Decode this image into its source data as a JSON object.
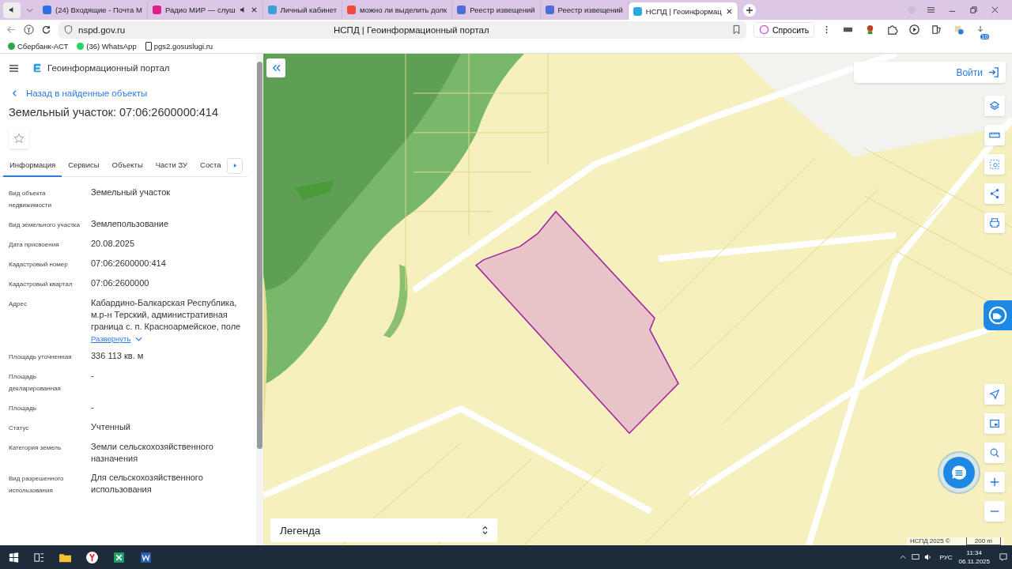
{
  "browser": {
    "tabs": [
      {
        "title": "(24) Входящие - Почта М",
        "selected": false,
        "playing": false,
        "color": "#2f6fe0"
      },
      {
        "title": "Радио МИР — слуш",
        "selected": false,
        "playing": true,
        "color": "#e0208a"
      },
      {
        "title": "Личный кабинет",
        "selected": false,
        "playing": false,
        "color": "#3aa0d8"
      },
      {
        "title": "можно ли выделить долк",
        "selected": false,
        "playing": false,
        "color": "#f04a3a"
      },
      {
        "title": "Реестр извещений",
        "selected": false,
        "playing": false,
        "color": "#4a6fd8"
      },
      {
        "title": "Реестр извещений",
        "selected": false,
        "playing": false,
        "color": "#4a6fd8"
      },
      {
        "title": "НСПД | Геоинформац",
        "selected": true,
        "playing": false,
        "color": "#2aa8e0"
      }
    ],
    "url": "nspd.gov.ru",
    "page_title": "НСПД | Геоинформационный портал",
    "ask_button": "Спросить",
    "downloads_badge": "10",
    "bookmarks": [
      "Сбербанк-АСТ",
      "(36) WhatsApp",
      "pgs2.gosuslugi.ru"
    ]
  },
  "panel": {
    "app_title": "Геоинформационный портал",
    "back_link": "Назад в найденные объекты",
    "heading": "Земельный участок: 07:06:2600000:414",
    "tabs": [
      {
        "label": "Информация",
        "selected": true
      },
      {
        "label": "Сервисы",
        "selected": false
      },
      {
        "label": "Объекты",
        "selected": false
      },
      {
        "label": "Части ЗУ",
        "selected": false
      },
      {
        "label": "Соста",
        "selected": false
      }
    ],
    "fields": [
      {
        "label": "Вид объекта недвижимости",
        "value": "Земельный участок"
      },
      {
        "label": "Вид земельного участка",
        "value": "Землепользование"
      },
      {
        "label": "Дата присвоения",
        "value": "20.08.2025"
      },
      {
        "label": "Кадастровый номер",
        "value": "07:06:2600000:414"
      },
      {
        "label": "Кадастровый квартал",
        "value": "07:06:2600000"
      },
      {
        "label": "Адрес",
        "value": "Кабардино-Балкарская Республика, м.р-н Терский, административная граница с. п. Красноармейское, поле",
        "link": "Развернуть"
      },
      {
        "label": "Площадь уточненная",
        "value": "336 113 кв. м"
      },
      {
        "label": "Площадь декларированная",
        "value": "-"
      },
      {
        "label": "Площадь",
        "value": "-"
      },
      {
        "label": "Статус",
        "value": "Учтенный"
      },
      {
        "label": "Категория земель",
        "value": "Земли сельскохозяйственного назначения"
      },
      {
        "label": "Вид разрешенного использования",
        "value": "Для сельскохозяйственного использования"
      }
    ]
  },
  "map": {
    "login_button": "Войти",
    "legend": "Легенда",
    "attribution": "НСПД 2025 ©",
    "scale": "200 m"
  },
  "taskbar": {
    "language": "РУС",
    "time": "11:34",
    "date": "06.11.2025"
  }
}
